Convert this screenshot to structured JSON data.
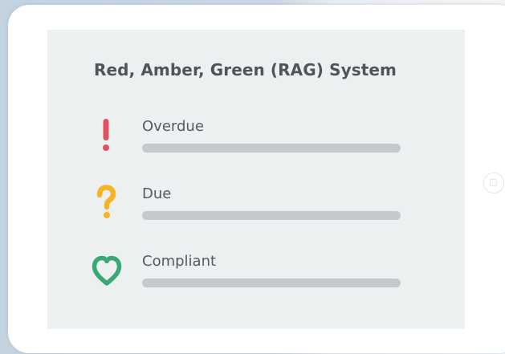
{
  "title": "Red, Amber, Green (RAG) System",
  "items": [
    {
      "label": "Overdue",
      "icon": "exclamation-icon",
      "color": "#e0505f"
    },
    {
      "label": "Due",
      "icon": "question-icon",
      "color": "#f6b325"
    },
    {
      "label": "Compliant",
      "icon": "heart-icon",
      "color": "#3aa876"
    }
  ],
  "colors": {
    "screen_background": "#ecf0f1",
    "bar": "#c6c9cb",
    "text": "#4f5459"
  }
}
